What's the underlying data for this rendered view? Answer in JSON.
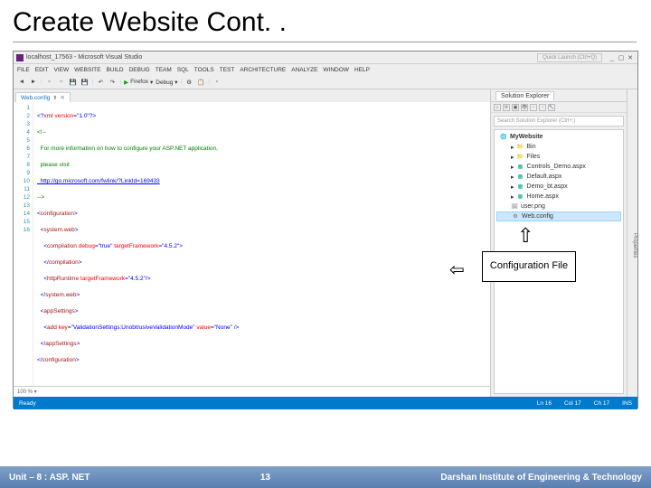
{
  "slide": {
    "title": "Create Website Cont. ."
  },
  "vs": {
    "title": "localhost_17563 - Microsoft Visual Studio",
    "quicklaunch": "Quick Launch (Ctrl+Q)",
    "menu": [
      "FILE",
      "EDIT",
      "VIEW",
      "WEBSITE",
      "BUILD",
      "DEBUG",
      "TEAM",
      "SQL",
      "TOOLS",
      "TEST",
      "ARCHITECTURE",
      "ANALYZE",
      "WINDOW",
      "HELP"
    ],
    "toolbar": {
      "browser": "Firefox",
      "config": "Debug"
    },
    "tab": {
      "name": "Web.config"
    },
    "linenums": [
      "1",
      "2",
      "3",
      "4",
      "5",
      "6",
      "7",
      "8",
      "9",
      "10",
      "11",
      "12",
      "13",
      "14",
      "15",
      "16"
    ],
    "code": {
      "l1a": "<?",
      "l1b": "xml",
      "l1c": " version",
      "l1d": "=\"1.0\"",
      "l1e": "?>",
      "l2a": "<!--",
      "l3": "  For more information on how to configure your ASP.NET application,",
      "l4": "  please visit",
      "l5": "  http://go.microsoft.com/fwlink/?LinkId=169433",
      "l6": "-->",
      "l7a": "<",
      "l7b": "configuration",
      "l7c": ">",
      "l8a": "  <",
      "l8b": "system.web",
      "l8c": ">",
      "l9a": "    <",
      "l9b": "compilation",
      "l9c": " debug",
      "l9d": "=\"true\"",
      "l9e": " targetFramework",
      "l9f": "=\"4.5.2\"",
      "l9g": ">",
      "l10a": "    </",
      "l10b": "compilation",
      "l10c": ">",
      "l11a": "    <",
      "l11b": "httpRuntime",
      "l11c": " targetFramework",
      "l11d": "=\"4.5.2\"",
      "l11e": "/>",
      "l12a": "  </",
      "l12b": "system.web",
      "l12c": ">",
      "l13a": "  <",
      "l13b": "appSettings",
      "l13c": ">",
      "l14a": "    <",
      "l14b": "add",
      "l14c": " key",
      "l14d": "=\"ValidationSettings:UnobtrusiveValidationMode\"",
      "l14e": " value",
      "l14f": "=\"None\"",
      "l14g": " />",
      "l15a": "  </",
      "l15b": "appSettings",
      "l15c": ">",
      "l16a": "</",
      "l16b": "configuration",
      "l16c": ">"
    },
    "zoom": "100 %  ▾",
    "panel": {
      "title": "Solution Explorer",
      "search": "Search Solution Explorer (Ctrl+;)",
      "root": "MyWebsite",
      "items": [
        {
          "label": "Bin",
          "icon": "folder"
        },
        {
          "label": "Files",
          "icon": "folder"
        },
        {
          "label": "Controls_Demo.aspx",
          "icon": "aspx"
        },
        {
          "label": "Default.aspx",
          "icon": "aspx"
        },
        {
          "label": "Demo_bt.aspx",
          "icon": "aspx"
        },
        {
          "label": "Home.aspx",
          "icon": "aspx"
        },
        {
          "label": "user.png",
          "icon": "png"
        },
        {
          "label": "Web.config",
          "icon": "config"
        }
      ]
    },
    "rightgutter": "Properties",
    "status": {
      "ready": "Ready",
      "ln": "Ln 16",
      "col": "Col 17",
      "ch": "Ch 17",
      "ins": "INS"
    }
  },
  "callout": {
    "text": "Configuration File"
  },
  "footer": {
    "left": "Unit – 8 : ASP. NET",
    "center": "13",
    "right": "Darshan Institute of Engineering & Technology"
  }
}
